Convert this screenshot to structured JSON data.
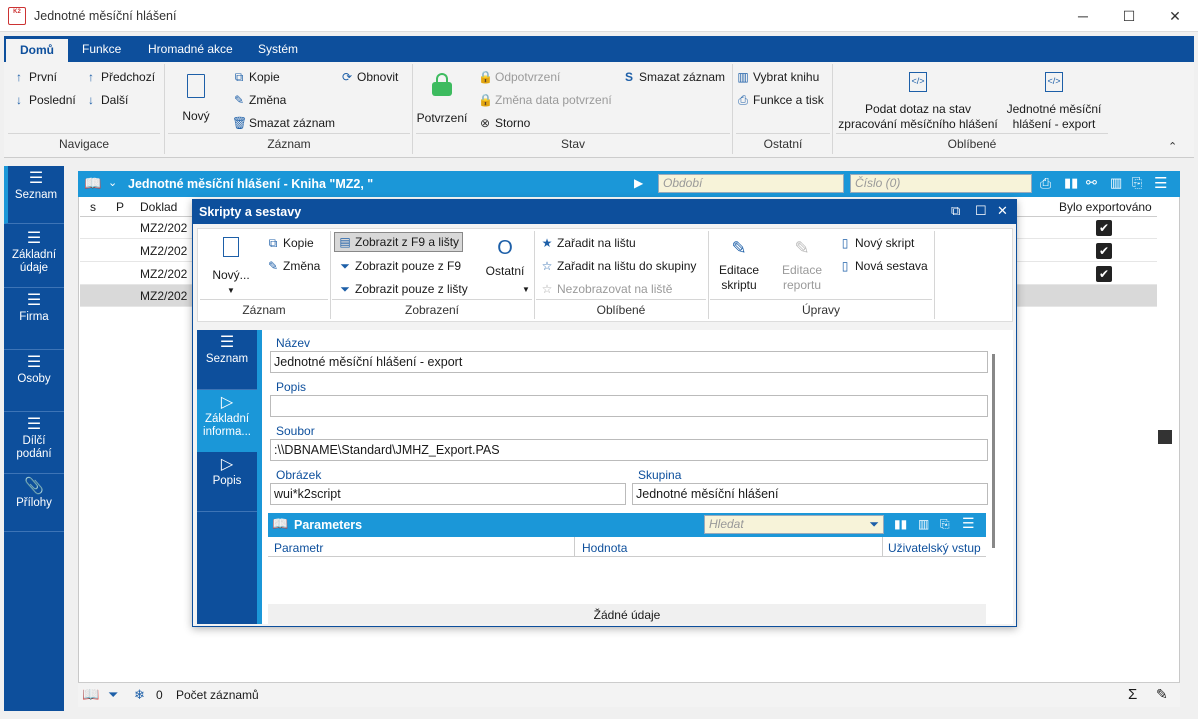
{
  "window": {
    "title": "Jednotné měsíční hlášení",
    "logo_text": "K2"
  },
  "ribbon_tabs": [
    "Domů",
    "Funkce",
    "Hromadné akce",
    "Systém"
  ],
  "ribbon": {
    "navigace": {
      "label": "Navigace",
      "prvni": "První",
      "posledni": "Poslední",
      "predchozi": "Předchozí",
      "dalsi": "Další"
    },
    "zaznam": {
      "label": "Záznam",
      "novy": "Nový",
      "kopie": "Kopie",
      "zmena": "Změna",
      "smazat": "Smazat záznam",
      "obnovit": "Obnovit"
    },
    "stav": {
      "label": "Stav",
      "potvrzeni": "Potvrzení",
      "odpotvrzeni": "Odpotvrzení",
      "zmena_data": "Změna data potvrzení",
      "storno": "Storno",
      "smazat": "Smazat záznam"
    },
    "ostatni": {
      "label": "Ostatní",
      "vybrat_knihu": "Vybrat knihu",
      "funkce_tisk": "Funkce a tisk"
    },
    "oblibene": {
      "label": "Oblíbené",
      "podat_dotaz": "Podat dotaz na stav zpracování měsíčního hlášení",
      "export": "Jednotné měsíční hlášení - export"
    }
  },
  "left_nav": [
    "Seznam",
    "Základní údaje",
    "Firma",
    "Osoby",
    "Dílčí podání",
    "Přílohy"
  ],
  "list": {
    "title": "Jednotné měsíční hlášení - Kniha \"MZ2, \"",
    "period_placeholder": "Období",
    "number_placeholder": "Číslo (0)",
    "columns": {
      "s": "s",
      "p": "P",
      "doklad": "Doklad",
      "exported": "Bylo exportováno"
    },
    "rows": [
      "MZ2/202",
      "MZ2/202",
      "MZ2/202",
      "MZ2/202"
    ],
    "exported": [
      true,
      true,
      true,
      false
    ]
  },
  "status": {
    "count": "0",
    "label": "Počet záznamů"
  },
  "dialog": {
    "title": "Skripty a sestavy",
    "ribbon": {
      "zaznam": {
        "label": "Záznam",
        "novy": "Nový...",
        "kopie": "Kopie",
        "zmena": "Změna"
      },
      "zobrazeni": {
        "label": "Zobrazení",
        "f9_listy": "Zobrazit z F9 a lišty",
        "pouze_f9": "Zobrazit pouze z F9",
        "pouze_listy": "Zobrazit pouze z lišty",
        "ostatni": "Ostatní"
      },
      "oblibene": {
        "label": "Oblíbené",
        "zaradit": "Zařadit na lištu",
        "zaradit_skupiny": "Zařadit na lištu do skupiny",
        "nezobrazovat": "Nezobrazovat na liště"
      },
      "upravy": {
        "label": "Úpravy",
        "editace_skriptu": "Editace skriptu",
        "editace_reportu": "Editace reportu",
        "novy_skript": "Nový skript",
        "nova_sestava": "Nová sestava"
      }
    },
    "nav": [
      "Seznam",
      "Základní informa...",
      "Popis"
    ],
    "form": {
      "nazev_label": "Název",
      "nazev": "Jednotné měsíční hlášení - export",
      "popis_label": "Popis",
      "popis": "",
      "soubor_label": "Soubor",
      "soubor": ":\\\\DBNAME\\Standard\\JMHZ_Export.PAS",
      "obrazek_label": "Obrázek",
      "obrazek": "wui*k2script",
      "skupina_label": "Skupina",
      "skupina": "Jednotné měsíční hlášení"
    },
    "params": {
      "title": "Parameters",
      "search_placeholder": "Hledat",
      "col_parametr": "Parametr",
      "col_hodnota": "Hodnota",
      "col_vstup": "Uživatelský vstup",
      "empty": "Žádné údaje"
    }
  },
  "colors": {
    "brand": "#0d4f9c",
    "accent": "#1b97d8",
    "filter_bg": "#f7f3d9"
  }
}
